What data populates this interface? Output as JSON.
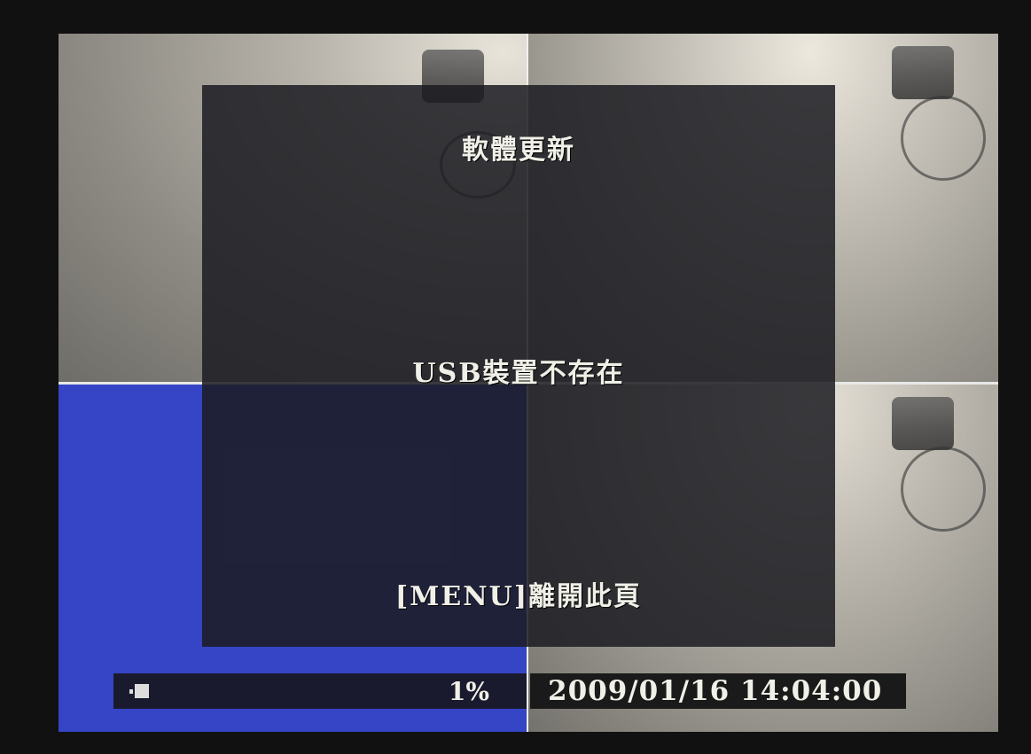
{
  "dialog": {
    "title": "軟體更新",
    "message": "USB裝置不存在",
    "exit_hint": "[MENU]離開此頁"
  },
  "status_bar": {
    "hdd_icon": "hdd-icon",
    "disk_usage": "1%",
    "datetime": "2009/01/16 14:04:00"
  },
  "colors": {
    "empty_channel": "#3545c5",
    "dialog_bg": "#1c1c22",
    "text": "#f0f0e8"
  }
}
